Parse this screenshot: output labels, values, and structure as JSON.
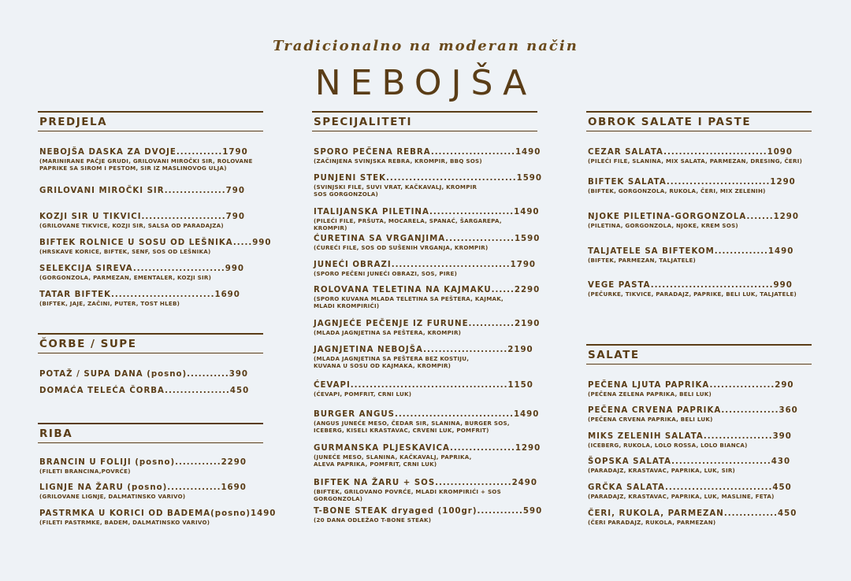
{
  "header": {
    "tagline": "Tradicionalno na moderan način",
    "title": "NEBOJŠA"
  },
  "columns": [
    {
      "sections": [
        {
          "title": "PREDJELA",
          "items": [
            {
              "name": "NEBOJŠA DASKA ZA DVOJE............1790",
              "desc": "(MARINIRANE PAČJE GRUDI, GRILOVANI MIROČKI SIR, ROLOVANE\nPAPRIKE SA SIROM I PESTOM, SIR IZ MASLINOVOG ULJA)"
            },
            {
              "name": "GRILOVANI MIROČKI SIR................790",
              "desc": ""
            },
            {
              "name": "KOZJI SIR U TIKVICI......................790",
              "desc": "(GRILOVANE TIKVICE, KOZJI SIR, SALSA OD PARADAJZA)"
            },
            {
              "name": "BIFTEK ROLNICE U SOSU OD LEŠNIKA.....990",
              "desc": "(HRSKAVE KORICE, BIFTEK, SENF, SOS OD LEŠNIKA)"
            },
            {
              "name": "SELEKCIJA SIREVA........................990",
              "desc": "(GORGONZOLA, PARMEZAN, EMENTALER, KOZJI SIR)"
            },
            {
              "name": "TATAR BIFTEK...........................1690",
              "desc": "(BIFTEK, JAJE, ZAČINI, PUTER, TOST HLEB)"
            }
          ]
        },
        {
          "title": "ČORBE / SUPE",
          "items": [
            {
              "name": "POTAŽ / SUPA DANA (posno)...........390",
              "desc": ""
            },
            {
              "name": "DOMAĆA TELEĆA ČORBA.................450",
              "desc": ""
            }
          ]
        },
        {
          "title": "RIBA",
          "items": [
            {
              "name": "BRANCIN U FOLIJI (posno)............2290",
              "desc": "(FILETI BRANCINA,POVRĆE)"
            },
            {
              "name": "LIGNJE NA ŽARU (posno)..............1690",
              "desc": "(GRILOVANE LIGNJE, DALMATINSKO VARIVO)"
            },
            {
              "name": "PASTRMKA U KORICI OD BADEMA(posno)1490",
              "desc": "(FILETI PASTRMKE, BADEM, DALMATINSKO VARIVO)"
            }
          ]
        }
      ]
    },
    {
      "sections": [
        {
          "title": "SPECIJALITETI",
          "items": [
            {
              "name": "SPORO PEČENA REBRA......................1490",
              "desc": "(ZAČINJENA SVINJSKA REBRA, KROMPIR, BBQ SOS)"
            },
            {
              "name": "PUNJENI STEK..................................1590",
              "desc": "(SVINJSKI FILE, SUVI VRAT, KAČKAVALJ, KROMPIR\nSOS GORGONZOLA)"
            },
            {
              "name": "ITALIJANSKA PILETINA......................1490",
              "desc": "(PILEĆI FILE, PRŠUTA, MOCARELA, SPANAĆ, ŠARGAREPA, KROMPIR)"
            },
            {
              "name": "ĆURETINA SA VRGANJIMA..................1590",
              "desc": "(ĆUREĆI FILE, SOS OD SUŠENIH VRGANJA, KROMPIR)"
            },
            {
              "name": "JUNEĆI OBRAZI...............................1790",
              "desc": "(SPORO PEČENI JUNEĆI OBRAZI, SOS, PIRE)"
            },
            {
              "name": "ROLOVANA TELETINA NA KAJMAKU......2290",
              "desc": "(SPORO KUVANA MLADA TELETINA SA PEŠTERA, KAJMAK,\nMLADI KROMPIRIĆI)"
            },
            {
              "name": "JAGNJEĆE PEČENJE IZ FURUNE............2190",
              "desc": "(MLADA JAGNJETINA SA PEŠTERA, KROMPIR)"
            },
            {
              "name": "JAGNJETINA NEBOJŠA......................2190",
              "desc": "(MLADA JAGNJETINA SA PEŠTERA BEZ KOSTIJU,\n KUVANA U SOSU OD KAJMAKA, KROMPIR)"
            },
            {
              "name": "ĆEVAPI.........................................1150",
              "desc": "(ĆEVAPI, POMFRIT, CRNI LUK)"
            },
            {
              "name": "BURGER ANGUS...............................1490",
              "desc": "(ANGUS JUNEĆE MESO, ČEDAR SIR, SLANINA, BURGER SOS,\nICEBERG, KISELI KRASTAVAC, CRVENI LUK, POMFRIT)"
            },
            {
              "name": "GURMANSKA PLJESKAVICA.................1290",
              "desc": "(JUNEĆE MESO, SLANINA, KAČKAVALJ, PAPRIKA,\nALEVA PAPRIKA, POMFRIT, CRNI LUK)"
            },
            {
              "name": "BIFTEK NA ŽARU + SOS....................2490",
              "desc": "(BIFTEK, GRILOVANO POVRĆE, MLADI KROMPIRIĆI + SOS GORGONZOLA)"
            },
            {
              "name": "T-BONE STEAK dryaged (100gr)............590",
              "desc": "(20 DANA ODLEŽAO T-BONE STEAK)"
            }
          ]
        }
      ]
    },
    {
      "sections": [
        {
          "title": "OBROK SALATE I PASTE",
          "items": [
            {
              "name": "CEZAR SALATA...........................1090",
              "desc": "(PILEĆI FILE, SLANINA, MIX SALATA, PARMEZAN, DRESING, ČERI)"
            },
            {
              "name": "BIFTEK SALATA...........................1290",
              "desc": "(BIFTEK, GORGONZOLA, RUKOLA, ČERI, MIX ZELENIH)"
            },
            {
              "name": "NJOKE PILETINA-GORGONZOLA.......1290",
              "desc": "(PILETINA, GORGONZOLA, NJOKE, KREM SOS)"
            },
            {
              "name": "TALJATELE SA BIFTEKOM..............1490",
              "desc": "(BIFTEK, PARMEZAN, TALJATELE)"
            },
            {
              "name": "VEGE PASTA................................990",
              "desc": "(PEČURKE, TIKVICE, PARADAJZ, PAPRIKE, BELI LUK, TALJATELE)"
            }
          ]
        },
        {
          "title": "SALATE",
          "items": [
            {
              "name": "PEČENA LJUTA PAPRIKA.................290",
              "desc": "(PEČENA ZELENA PAPRIKA, BELI LUK)"
            },
            {
              "name": "PEČENA CRVENA PAPRIKA...............360",
              "desc": "(PEČENA CRVENA PAPRIKA, BELI LUK)"
            },
            {
              "name": "MIKS ZELENIH SALATA..................390",
              "desc": "(ICEBERG, RUKOLA, LOLO ROSSA, LOLO BIANCA)"
            },
            {
              "name": "ŠOPSKA SALATA..........................430",
              "desc": "(PARADAJZ, KRASTAVAC, PAPRIKA, LUK, SIR)"
            },
            {
              "name": "GRČKA SALATA............................450",
              "desc": "(PARADAJZ, KRASTAVAC, PAPRIKA, LUK, MASLINE, FETA)"
            },
            {
              "name": "ČERI, RUKOLA, PARMEZAN..............450",
              "desc": "(ČERI PARADAJZ, RUKOLA, PARMEZAN)"
            }
          ]
        }
      ]
    }
  ]
}
